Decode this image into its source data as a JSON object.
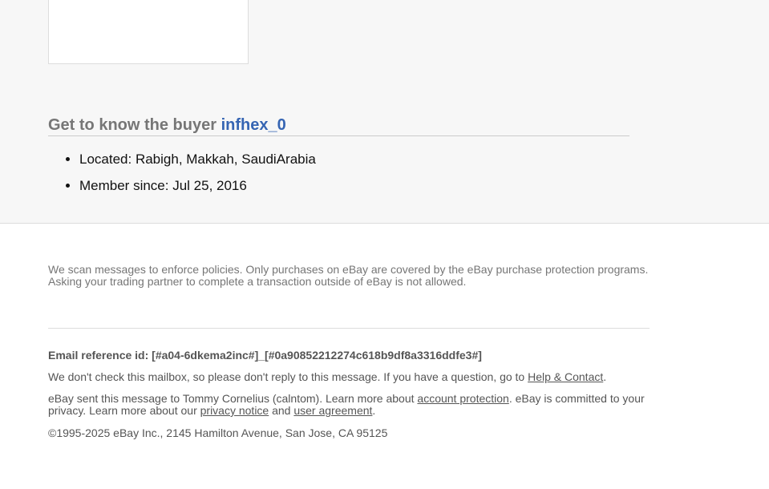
{
  "buyer_section": {
    "heading_prefix": "Get to know the buyer",
    "buyer_name": "infhex_0",
    "details": [
      "Located: Rabigh, Makkah, SaudiArabia",
      "Member since: Jul 25, 2016"
    ]
  },
  "footer": {
    "policy_line1": "We scan messages to enforce policies. Only purchases on eBay are covered by the eBay purchase protection programs.",
    "policy_line2": "Asking your trading partner to complete a transaction outside of eBay is not allowed.",
    "email_reference": "Email reference id: [#a04-6dkema2inc#]_[#0a90852212274c618b9df8a3316ddfe3#]",
    "no_reply_text": "We don't check this mailbox, so please don't reply to this message. If you have a question, go to ",
    "help_link": "Help & Contact",
    "no_reply_end": ".",
    "sent_text_1": "eBay sent this message to Tommy Cornelius (calntom). Learn more about ",
    "account_protection_link": "account protection",
    "sent_text_2": ". eBay is committed to your privacy. Learn more about our ",
    "privacy_notice_link": "privacy notice",
    "sent_text_3": " and ",
    "user_agreement_link": "user agreement",
    "sent_text_4": ".",
    "copyright": "©1995-2025 eBay Inc., 2145 Hamilton Avenue, San Jose, CA 95125"
  }
}
